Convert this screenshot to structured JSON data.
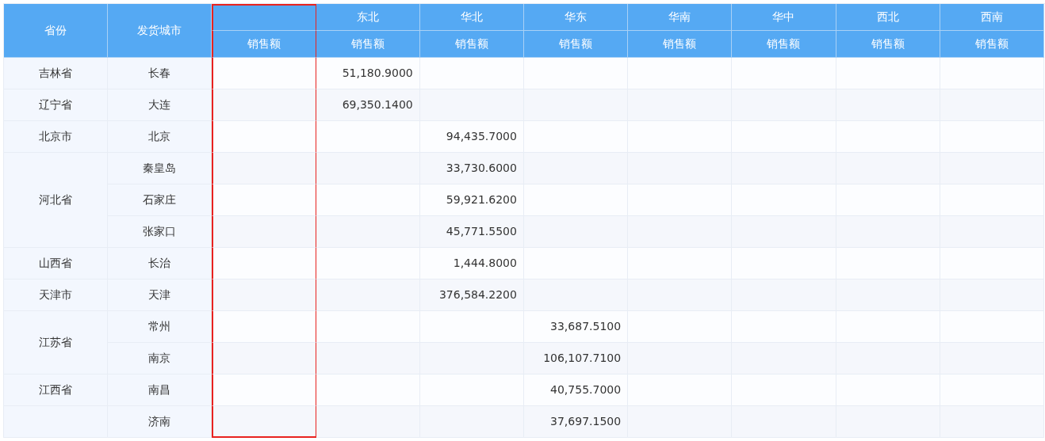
{
  "table": {
    "fixed_columns": [
      "省份",
      "发货城市"
    ],
    "region_columns": [
      {
        "sub_label": "销售额",
        "highlighted": true
      },
      {
        "label": "东北",
        "sub_label": "销售额",
        "highlighted": false
      },
      {
        "label": "华北",
        "sub_label": "销售额",
        "highlighted": false
      },
      {
        "label": "华东",
        "sub_label": "销售额",
        "highlighted": false
      },
      {
        "label": "华南",
        "sub_label": "销售额",
        "highlighted": false
      },
      {
        "label": "华中",
        "sub_label": "销售额",
        "highlighted": false
      },
      {
        "label": "西北",
        "sub_label": "销售额",
        "highlighted": false
      },
      {
        "label": "西南",
        "sub_label": "销售额",
        "highlighted": false
      }
    ],
    "groups": [
      {
        "province": "吉林省",
        "rows": [
          {
            "city": "长春",
            "cells": [
              {
                "kind": "empty"
              },
              {
                "kind": "amount",
                "value": "51,180.9000"
              },
              {
                "kind": "empty"
              },
              {
                "kind": "empty"
              },
              {
                "kind": "empty"
              },
              {
                "kind": "empty"
              },
              {
                "kind": "empty"
              },
              {
                "kind": "empty"
              }
            ]
          }
        ]
      },
      {
        "province": "辽宁省",
        "rows": [
          {
            "city": "大连",
            "cells": [
              {
                "kind": "empty"
              },
              {
                "kind": "amount",
                "value": "69,350.1400"
              },
              {
                "kind": "empty"
              },
              {
                "kind": "empty"
              },
              {
                "kind": "empty"
              },
              {
                "kind": "empty"
              },
              {
                "kind": "empty"
              },
              {
                "kind": "empty"
              }
            ]
          }
        ]
      },
      {
        "province": "北京市",
        "rows": [
          {
            "city": "北京",
            "cells": [
              {
                "kind": "empty"
              },
              {
                "kind": "empty"
              },
              {
                "kind": "amount",
                "value": "94,435.7000"
              },
              {
                "kind": "empty"
              },
              {
                "kind": "empty"
              },
              {
                "kind": "empty"
              },
              {
                "kind": "empty"
              },
              {
                "kind": "empty"
              }
            ]
          }
        ]
      },
      {
        "province": "河北省",
        "rows": [
          {
            "city": "秦皇岛",
            "cells": [
              {
                "kind": "empty"
              },
              {
                "kind": "empty"
              },
              {
                "kind": "amount",
                "value": "33,730.6000"
              },
              {
                "kind": "empty"
              },
              {
                "kind": "empty"
              },
              {
                "kind": "empty"
              },
              {
                "kind": "empty"
              },
              {
                "kind": "empty"
              }
            ]
          },
          {
            "city": "石家庄",
            "cells": [
              {
                "kind": "empty"
              },
              {
                "kind": "empty"
              },
              {
                "kind": "amount",
                "value": "59,921.6200"
              },
              {
                "kind": "empty"
              },
              {
                "kind": "empty"
              },
              {
                "kind": "empty"
              },
              {
                "kind": "empty"
              },
              {
                "kind": "empty"
              }
            ]
          },
          {
            "city": "张家口",
            "cells": [
              {
                "kind": "empty"
              },
              {
                "kind": "empty"
              },
              {
                "kind": "amount",
                "value": "45,771.5500"
              },
              {
                "kind": "empty"
              },
              {
                "kind": "empty"
              },
              {
                "kind": "empty"
              },
              {
                "kind": "empty"
              },
              {
                "kind": "empty"
              }
            ]
          }
        ]
      },
      {
        "province": "山西省",
        "rows": [
          {
            "city": "长治",
            "cells": [
              {
                "kind": "empty"
              },
              {
                "kind": "empty"
              },
              {
                "kind": "amount",
                "value": "1,444.8000"
              },
              {
                "kind": "empty"
              },
              {
                "kind": "empty"
              },
              {
                "kind": "empty"
              },
              {
                "kind": "empty"
              },
              {
                "kind": "empty"
              }
            ]
          }
        ]
      },
      {
        "province": "天津市",
        "rows": [
          {
            "city": "天津",
            "cells": [
              {
                "kind": "empty"
              },
              {
                "kind": "empty"
              },
              {
                "kind": "amount",
                "value": "376,584.2200"
              },
              {
                "kind": "empty"
              },
              {
                "kind": "empty"
              },
              {
                "kind": "empty"
              },
              {
                "kind": "empty"
              },
              {
                "kind": "empty"
              }
            ]
          }
        ]
      },
      {
        "province": "江苏省",
        "rows": [
          {
            "city": "常州",
            "cells": [
              {
                "kind": "empty"
              },
              {
                "kind": "empty"
              },
              {
                "kind": "empty"
              },
              {
                "kind": "amount",
                "value": "33,687.5100"
              },
              {
                "kind": "empty"
              },
              {
                "kind": "empty"
              },
              {
                "kind": "empty"
              },
              {
                "kind": "empty"
              }
            ]
          },
          {
            "city": "南京",
            "cells": [
              {
                "kind": "empty"
              },
              {
                "kind": "empty"
              },
              {
                "kind": "empty"
              },
              {
                "kind": "amount",
                "value": "106,107.7100"
              },
              {
                "kind": "empty"
              },
              {
                "kind": "empty"
              },
              {
                "kind": "empty"
              },
              {
                "kind": "empty"
              }
            ]
          }
        ]
      },
      {
        "province": "江西省",
        "rows": [
          {
            "city": "南昌",
            "cells": [
              {
                "kind": "empty"
              },
              {
                "kind": "empty"
              },
              {
                "kind": "empty"
              },
              {
                "kind": "amount",
                "value": "40,755.7000"
              },
              {
                "kind": "empty"
              },
              {
                "kind": "empty"
              },
              {
                "kind": "empty"
              },
              {
                "kind": "empty"
              }
            ]
          }
        ]
      },
      {
        "rows": [
          {
            "city": "济南",
            "cells": [
              {
                "kind": "empty"
              },
              {
                "kind": "empty"
              },
              {
                "kind": "empty"
              },
              {
                "kind": "amount",
                "value": "37,697.1500"
              },
              {
                "kind": "empty"
              },
              {
                "kind": "empty"
              },
              {
                "kind": "empty"
              },
              {
                "kind": "empty"
              }
            ]
          }
        ]
      }
    ]
  }
}
